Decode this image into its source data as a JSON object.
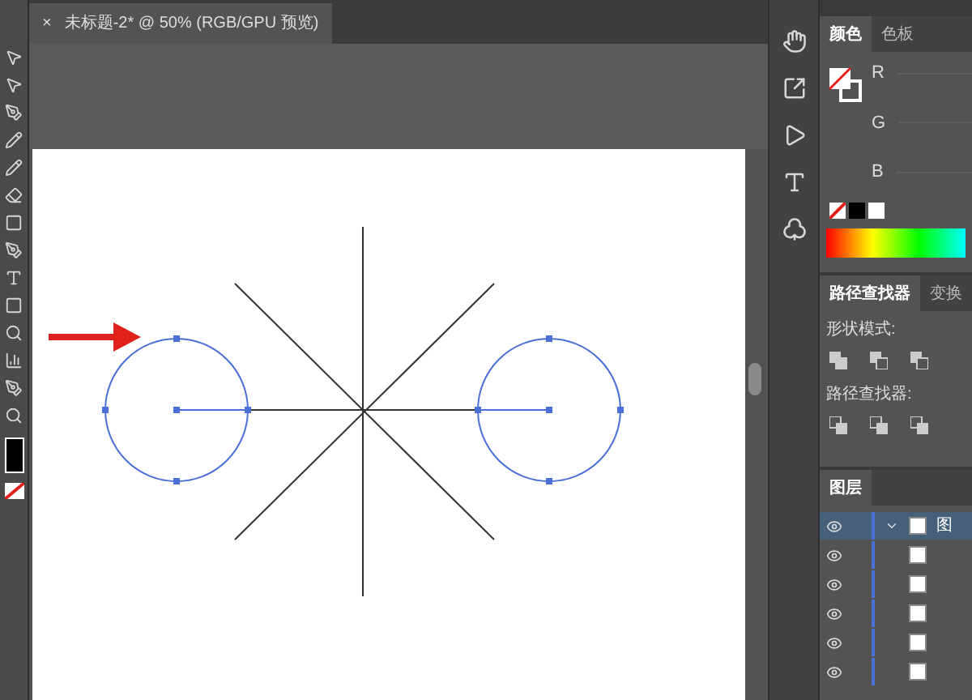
{
  "document_tab": {
    "close": "×",
    "title": "未标题-2* @ 50% (RGB/GPU 预览)",
    "selected": true
  },
  "color_panel": {
    "tabs": [
      {
        "label": "颜色",
        "selected": true
      },
      {
        "label": "色板",
        "selected": false
      }
    ],
    "channels": [
      "R",
      "G",
      "B"
    ]
  },
  "pathfinder_panel": {
    "tabs": [
      {
        "label": "路径查找器",
        "selected": true
      },
      {
        "label": "变换",
        "selected": false
      }
    ],
    "shape_modes_label": "形状模式:",
    "pathfinders_label": "路径查找器:"
  },
  "layers_panel": {
    "tab": "图层",
    "layers": [
      {
        "name": "图",
        "selected": true
      },
      {
        "selected": false
      },
      {
        "selected": false
      },
      {
        "selected": false
      },
      {
        "selected": false
      },
      {
        "selected": false
      }
    ]
  }
}
